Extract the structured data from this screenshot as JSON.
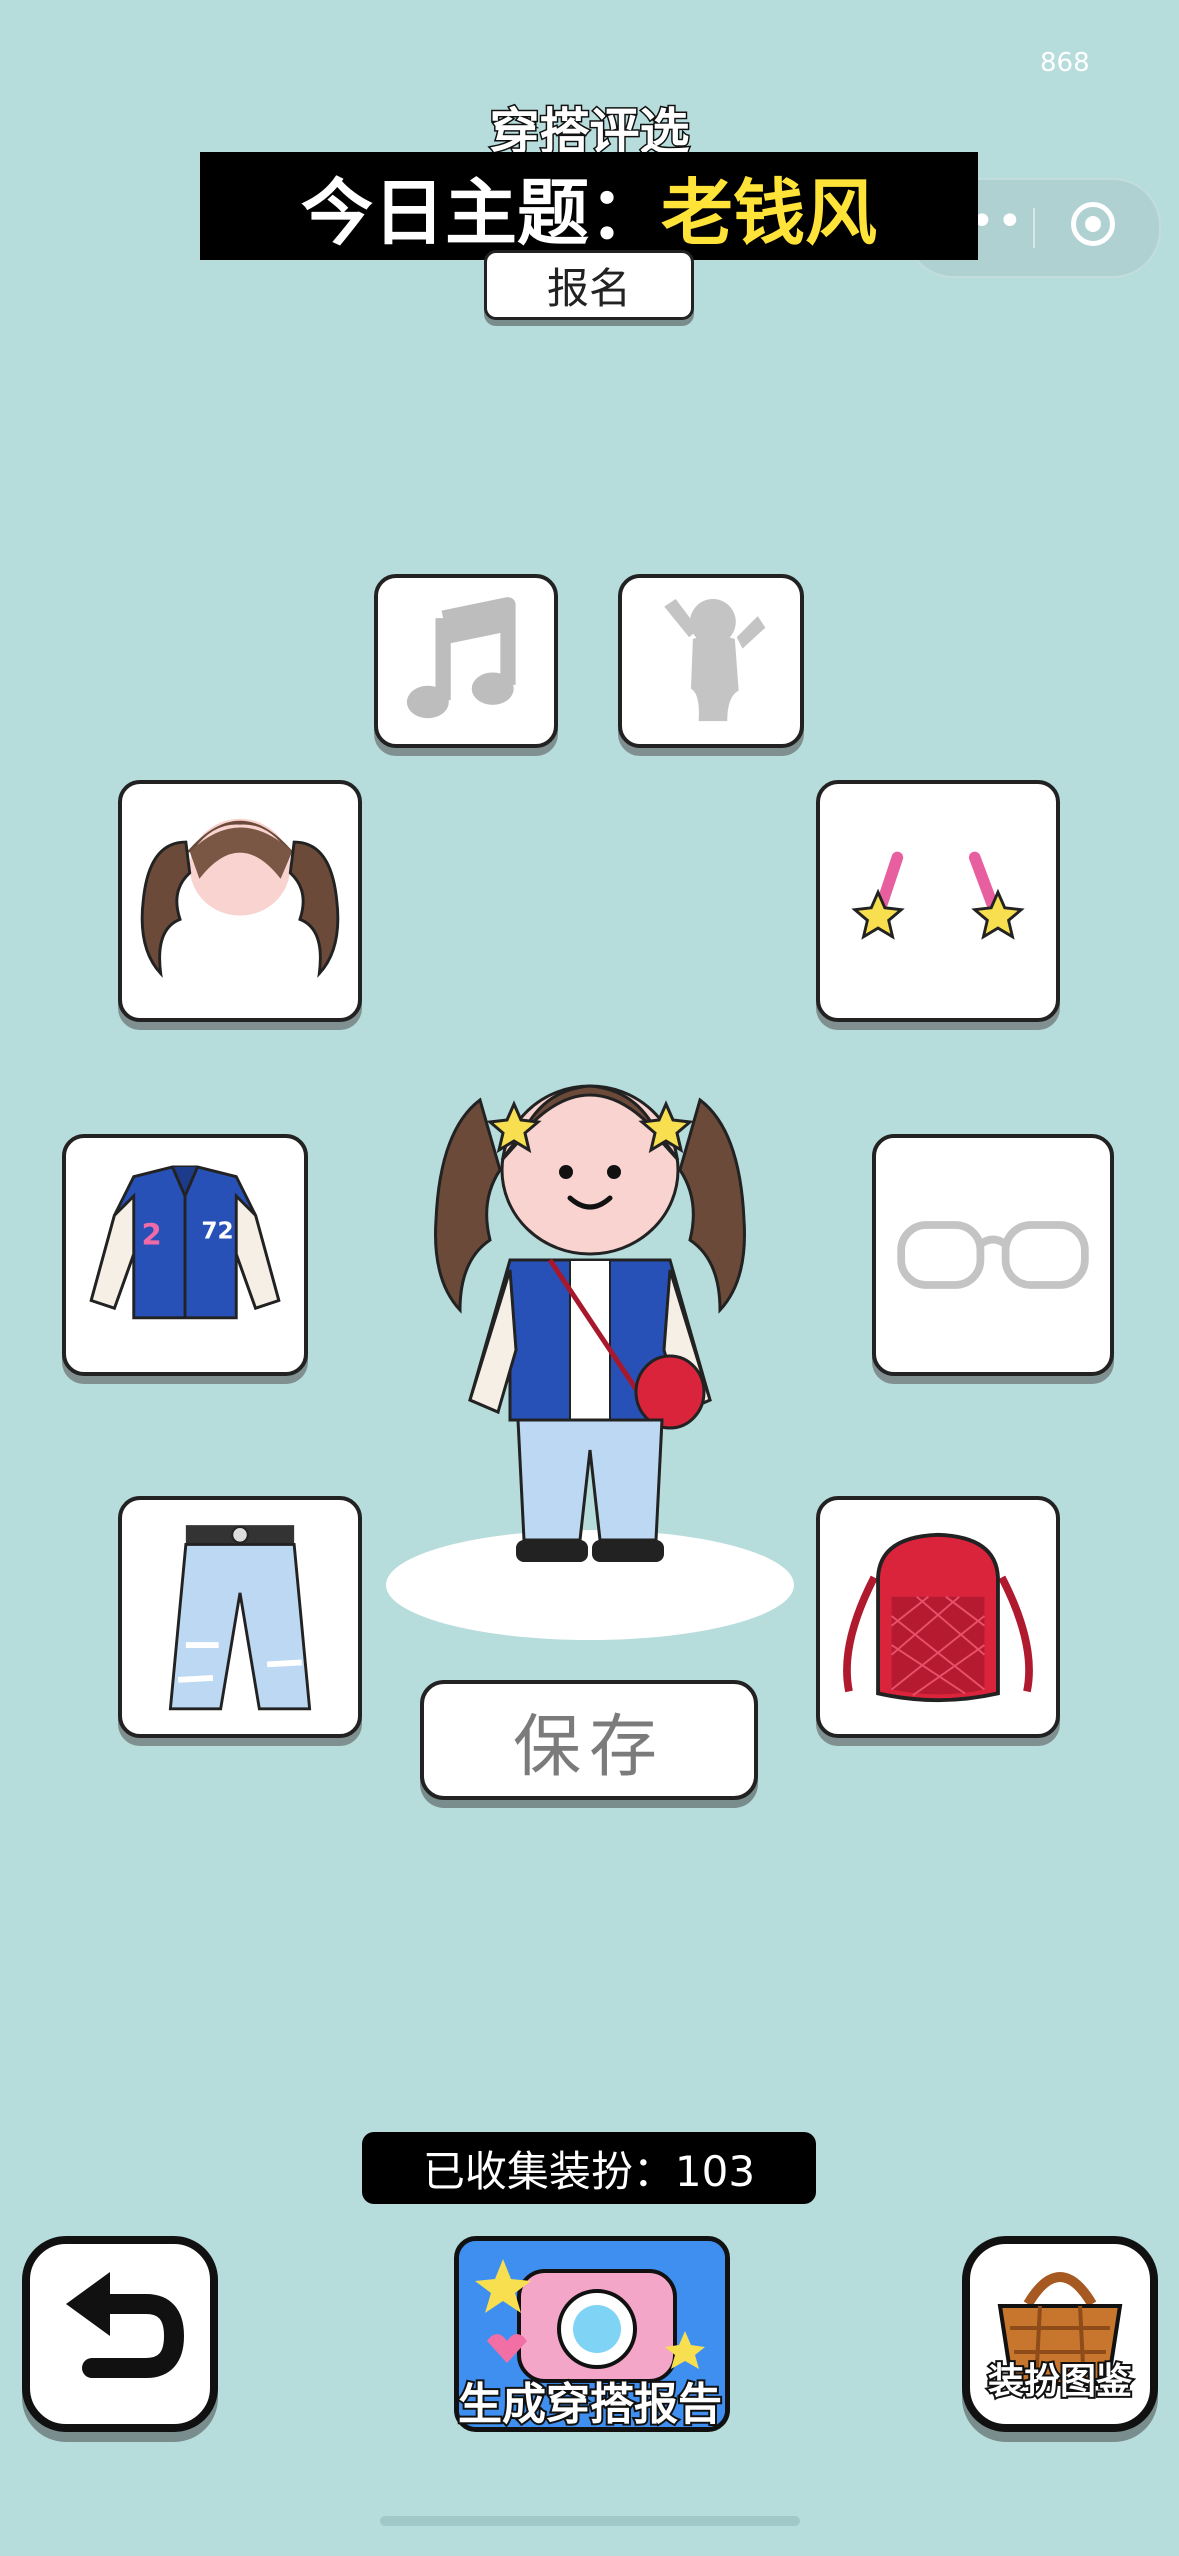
{
  "status": {
    "counter": "868"
  },
  "header": {
    "event_title": "穿搭评选",
    "theme_label": "今日主题：",
    "theme_value": "老钱风",
    "signup_label": "报名"
  },
  "slots": {
    "music": "music-icon",
    "pose": "pose-silhouette-icon",
    "hair": "twin-ponytail-hair",
    "accessory": "star-hairclips",
    "jacket": "varsity-jacket",
    "glasses": "glasses-outline",
    "pants": "ripped-jeans",
    "bag": "red-quilted-backpack"
  },
  "actions": {
    "save_label": "保存",
    "report_label": "生成穿搭报告",
    "catalog_label": "装扮图鉴"
  },
  "collection": {
    "collected_text": "已收集装扮：103"
  },
  "colors": {
    "background": "#b7dcdc",
    "theme_highlight": "#ffe338",
    "banner": "#000000"
  }
}
